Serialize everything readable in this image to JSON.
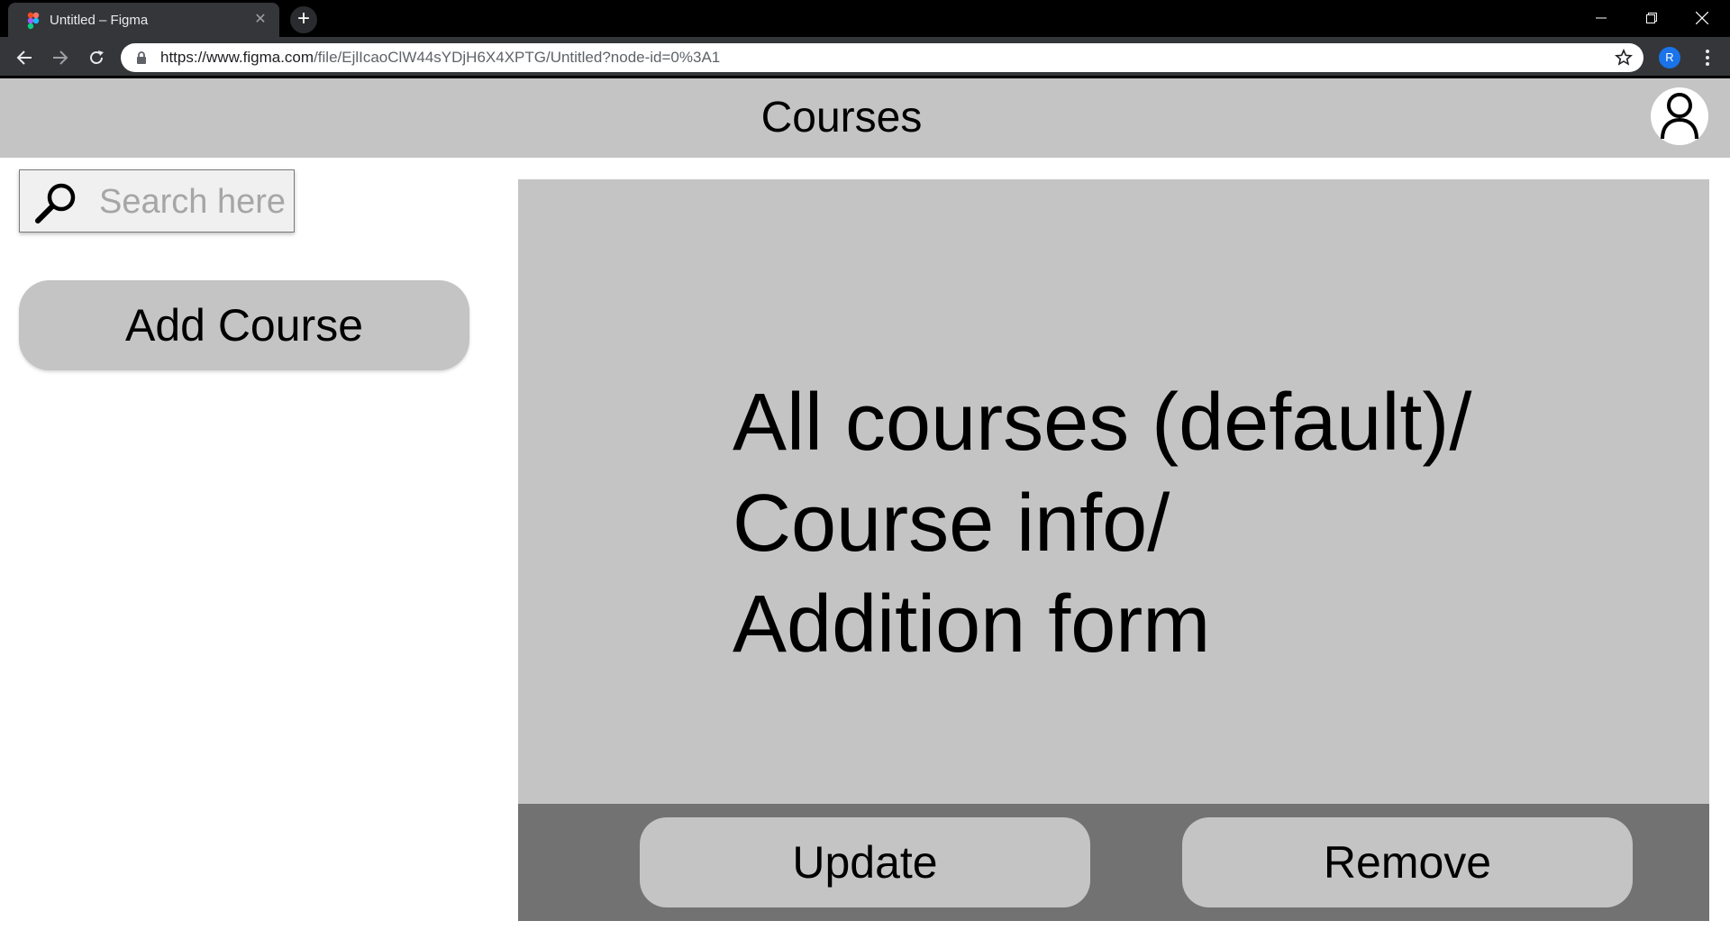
{
  "browser": {
    "tab_title": "Untitled – Figma",
    "tab_close_glyph": "✕",
    "new_tab_glyph": "+",
    "url_host": "https://www.figma.com",
    "url_rest": "/file/EjlIcaoClW44sYDjH6X4XPTG/Untitled?node-id=0%3A1",
    "profile_initial": "R",
    "icons": [
      "figma-icon",
      "close-icon",
      "plus-icon",
      "minimize-icon",
      "restore-icon",
      "close-window-icon",
      "back-arrow-icon",
      "forward-arrow-icon",
      "reload-icon",
      "lock-icon",
      "star-icon",
      "more-vert-icon"
    ]
  },
  "header": {
    "title": "Courses",
    "avatar_icon": "user-icon",
    "background": "#c4c4c4"
  },
  "sidebar": {
    "search_placeholder": "Search here",
    "search_value": "",
    "search_icon": "magnifier-icon",
    "add_button_label": "Add Course"
  },
  "main": {
    "panel_lines": [
      "All courses (default)/",
      "Course info/",
      "Addition form"
    ],
    "update_label": "Update",
    "remove_label": "Remove",
    "panel_color": "#c4c4c4",
    "action_bar_color": "#727272"
  }
}
